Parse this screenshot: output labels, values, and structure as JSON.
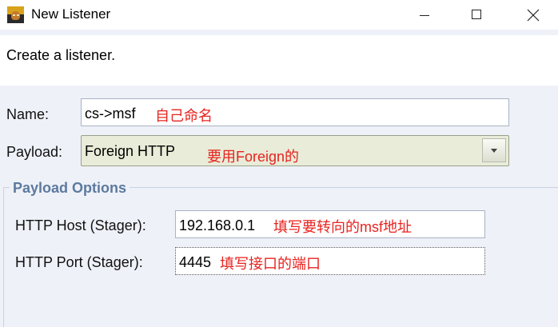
{
  "window": {
    "title": "New Listener",
    "icon": "app-avatar-icon"
  },
  "header": {
    "description": "Create a listener."
  },
  "form": {
    "name": {
      "label": "Name:",
      "value": "cs->msf",
      "annotation": "自己命名"
    },
    "payload": {
      "label": "Payload:",
      "value": "Foreign HTTP",
      "annotation": "要用Foreign的"
    }
  },
  "payload_options": {
    "title": "Payload Options",
    "host": {
      "label": "HTTP Host (Stager):",
      "value": "192.168.0.1",
      "annotation": "填写要转向的msf地址"
    },
    "port": {
      "label": "HTTP Port (Stager):",
      "value": "4445",
      "annotation": "填写接口的端口"
    }
  },
  "colors": {
    "annotation": "#e8231f",
    "group_title": "#5d7a9e",
    "background": "#eef1f8"
  }
}
